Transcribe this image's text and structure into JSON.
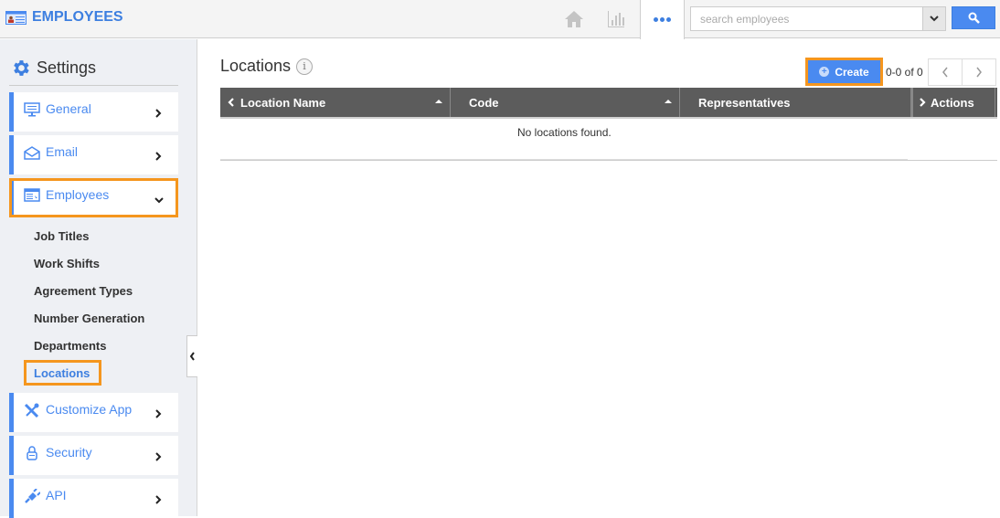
{
  "app": {
    "title": "EMPLOYEES"
  },
  "topbar": {
    "icons": [
      "home-icon",
      "chart-icon",
      "more-icon"
    ],
    "search": {
      "placeholder": "search employees",
      "value": ""
    }
  },
  "sidebar": {
    "heading": "Settings",
    "items": [
      {
        "label": "General",
        "icon": "monitor-icon"
      },
      {
        "label": "Email",
        "icon": "envelope-icon"
      },
      {
        "label": "Employees",
        "icon": "window-icon",
        "expanded": true
      },
      {
        "label": "Customize App",
        "icon": "tools-icon"
      },
      {
        "label": "Security",
        "icon": "lock-icon"
      },
      {
        "label": "API",
        "icon": "plug-icon"
      }
    ],
    "sub_items": [
      {
        "label": "Job Titles"
      },
      {
        "label": "Work Shifts"
      },
      {
        "label": "Agreement Types"
      },
      {
        "label": "Number Generation"
      },
      {
        "label": "Departments"
      },
      {
        "label": "Locations",
        "active": true
      }
    ]
  },
  "main": {
    "title": "Locations",
    "info_glyph": "i",
    "create_label": "Create",
    "pager_text": "0-0 of 0",
    "columns": [
      "Location Name",
      "Code",
      "Representatives",
      "Actions"
    ],
    "empty_message": "No locations found."
  },
  "colors": {
    "accent": "#4a8af0",
    "highlight": "#f5961e",
    "header": "#5c5c5c"
  }
}
